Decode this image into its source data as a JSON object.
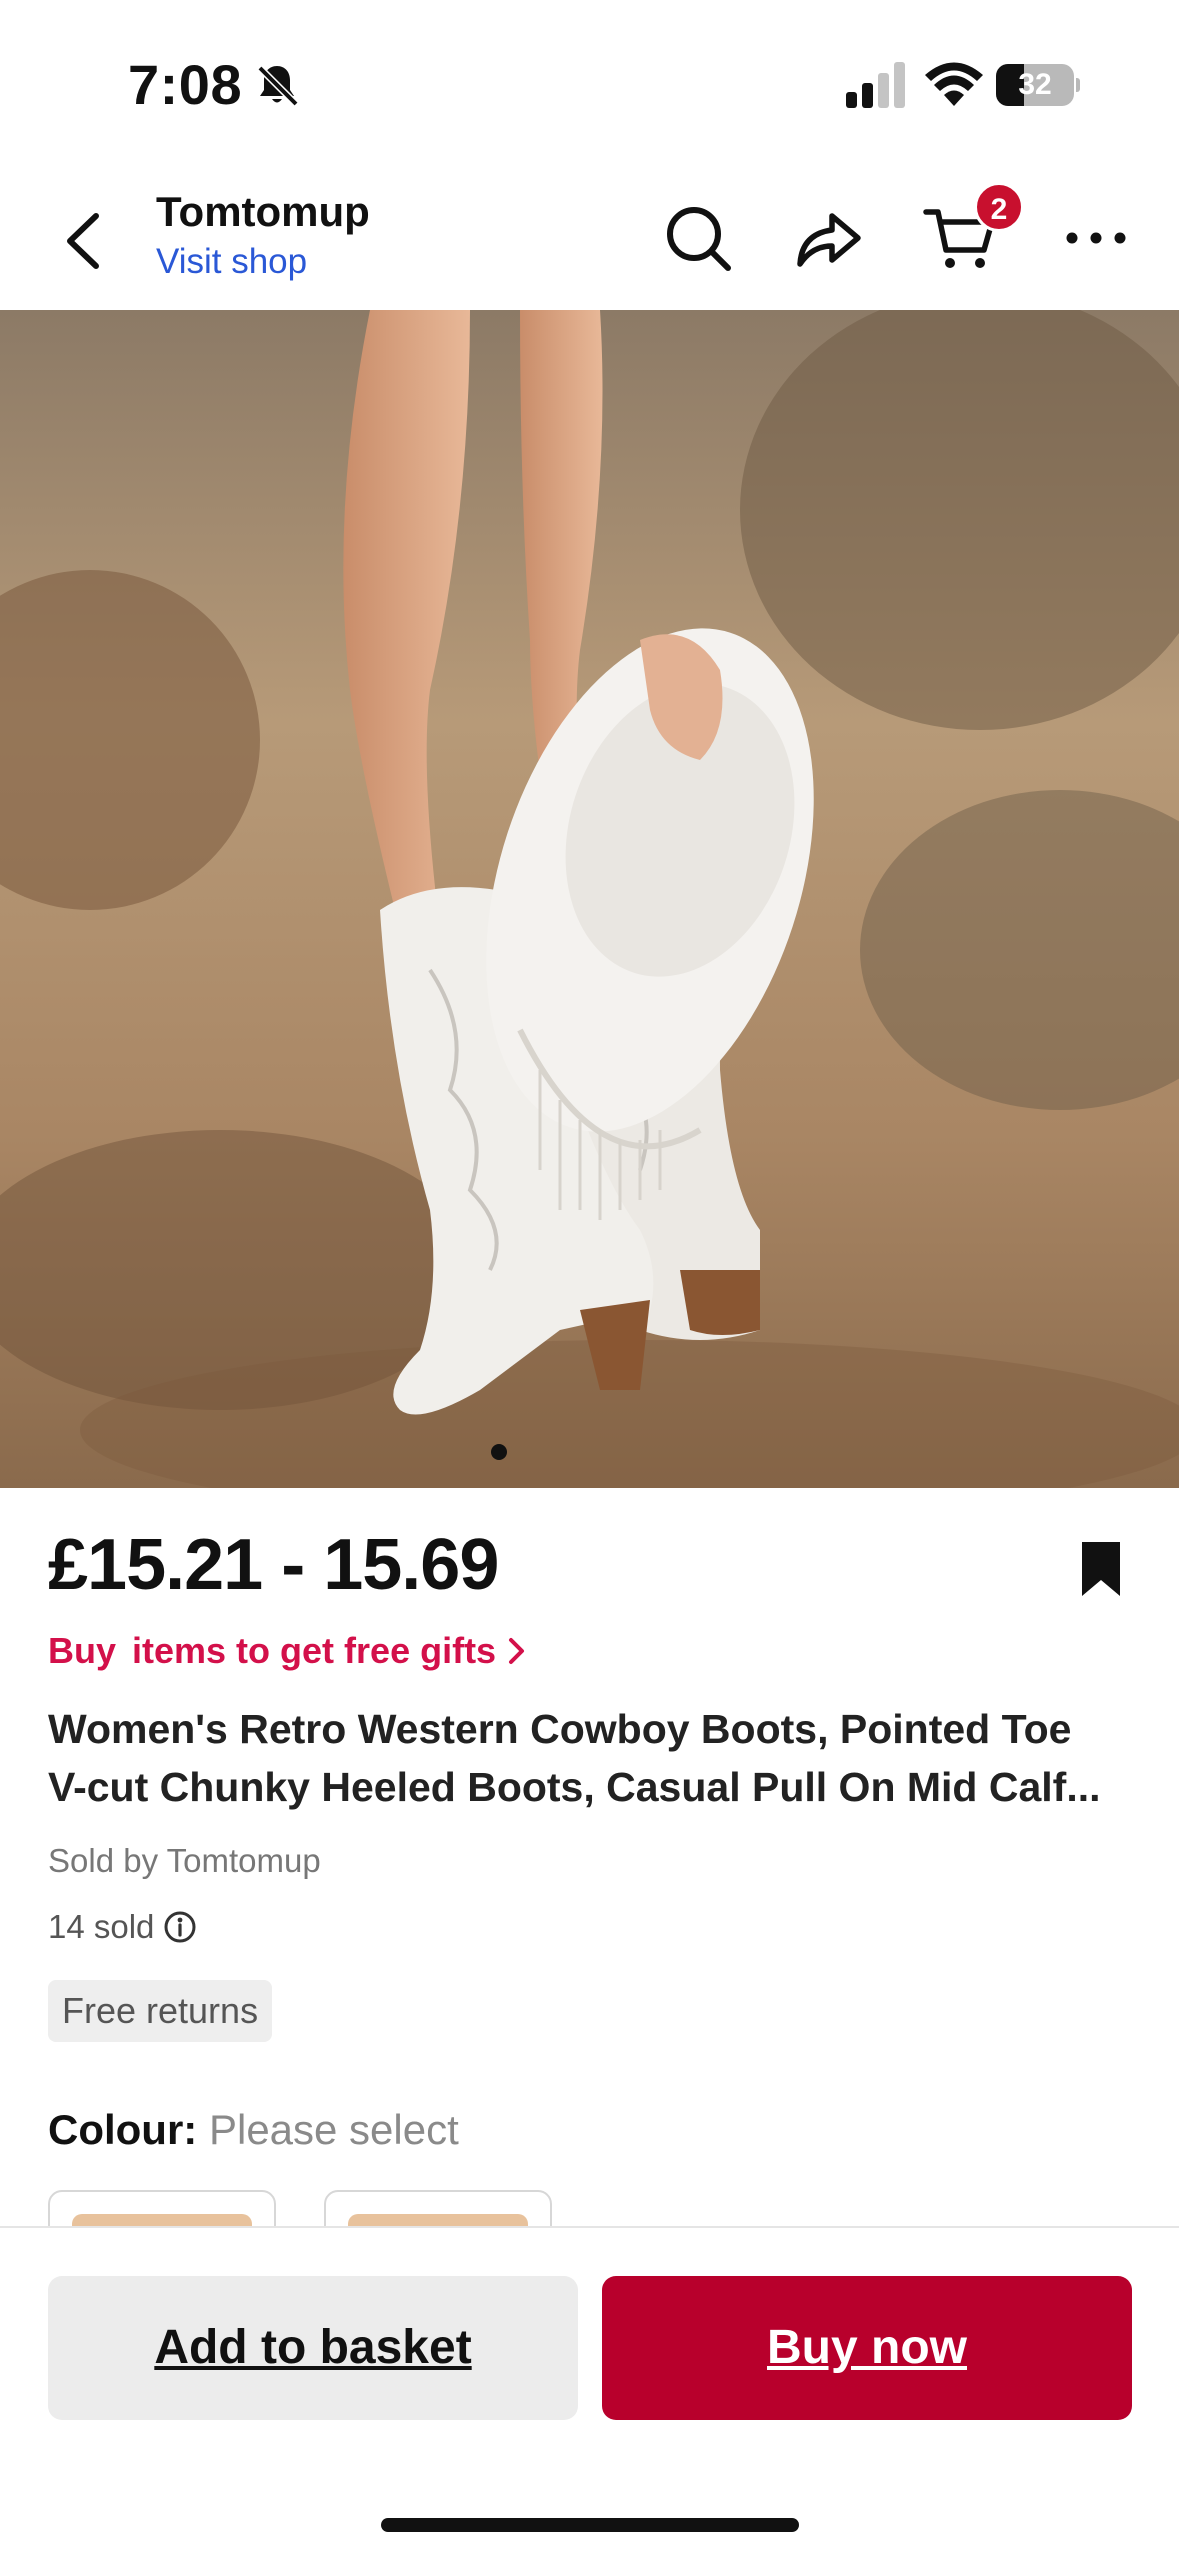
{
  "status_bar": {
    "time": "7:08",
    "battery": "32",
    "icons": [
      "bell-muted-icon",
      "cellular-signal-icon",
      "wifi-icon",
      "battery-icon"
    ]
  },
  "header": {
    "shop_name": "Tomtomup",
    "visit_shop": "Visit shop",
    "cart_count": "2",
    "icons": [
      "back-chevron-icon",
      "search-icon",
      "share-arrow-icon",
      "cart-icon",
      "more-dots-icon"
    ]
  },
  "gallery": {
    "description_icons": [
      "product-photo"
    ],
    "current_index": 1
  },
  "product": {
    "price": "£15.21 - 15.69",
    "gift_prefix": "Buy",
    "gift_text": "items to get free gifts",
    "title_line1": "Women's Retro Western Cowboy Boots, Pointed Toe",
    "title_line2": "V-cut Chunky Heeled Boots, Casual Pull On Mid Calf...",
    "sold_by": "Sold by Tomtomup",
    "sold_count": "14 sold",
    "free_returns": "Free returns",
    "colour_label": "Colour:",
    "colour_value": "Please select"
  },
  "actions": {
    "add_to_basket": "Add to basket",
    "buy_now": "Buy now"
  },
  "colors": {
    "accent_red": "#b8002c",
    "gift_pink": "#d3104a",
    "link_blue": "#2a58d6"
  }
}
